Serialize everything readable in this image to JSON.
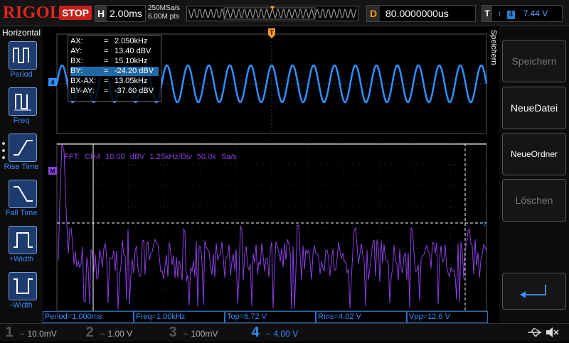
{
  "brand": {
    "name": "RIGOL"
  },
  "header": {
    "run_state": "STOP",
    "timebase_label": "H",
    "timebase_value": "2.00ms",
    "sample_rate": "250MSa/s",
    "memory_depth": "6.00M pts",
    "delay_label": "D",
    "delay_value": "80.0000000us",
    "trigger_label": "T",
    "trigger_source": "4",
    "trigger_level": "7.44 V"
  },
  "left_menu": {
    "title": "Horizontal",
    "items": [
      {
        "label": "Period"
      },
      {
        "label": "Freq"
      },
      {
        "label": "Rise Time"
      },
      {
        "label": "Fall Time"
      },
      {
        "label": "+Width"
      },
      {
        "label": "-Width"
      }
    ]
  },
  "cursor": {
    "rows": [
      {
        "key": "AX:",
        "value": "2.050kHz"
      },
      {
        "key": "AY:",
        "value": "13.40 dBV"
      },
      {
        "key": "BX:",
        "value": "15.10kHz"
      },
      {
        "key": "BY:",
        "value": "-24.20 dBV"
      },
      {
        "key": "BX-AX:",
        "value": "13.05kHz"
      },
      {
        "key": "BY-AY:",
        "value": "-37.60 dBV"
      }
    ],
    "selected_row": "BY:",
    "eq": "="
  },
  "markers": {
    "trigger": "T",
    "channel_top": "4",
    "math": "M"
  },
  "fft": {
    "label": "FFT: CH4 10.00 dBV 1.25kHz/Div 50.0k Sa/s"
  },
  "measurements": [
    {
      "label": "Period=1.000ms"
    },
    {
      "label": "Freq=1.00kHz"
    },
    {
      "label": "Top=6.72 V"
    },
    {
      "label": "Rms=4.02 V"
    },
    {
      "label": "Vpp=12.6 V"
    }
  ],
  "right_menu": {
    "title": "Speichern",
    "items": [
      {
        "label": "Speichern",
        "enabled": false
      },
      {
        "label": "NeueDatei",
        "enabled": true
      },
      {
        "label": "NeueOrdner",
        "enabled": true
      },
      {
        "label": "Löschen",
        "enabled": false
      }
    ]
  },
  "channels": [
    {
      "num": "1",
      "coupling": "~",
      "scale": "10.0mV",
      "color": "#d8d000"
    },
    {
      "num": "2",
      "coupling": "~",
      "scale": "1.00 V",
      "color": "#33cccc"
    },
    {
      "num": "3",
      "coupling": "~",
      "scale": "100mV",
      "color": "#d040d0"
    },
    {
      "num": "4",
      "coupling": "~",
      "scale": "4.00 V",
      "color": "#2f8fff"
    }
  ],
  "colors": {
    "ch4": "#2f8fff",
    "math": "#8a3fe0",
    "trigger": "#ff9a1a",
    "accent": "#c8201c"
  },
  "icons": {
    "usb": "usb-icon",
    "sound": "speaker-mute-icon",
    "back": "return-arrow-icon"
  }
}
